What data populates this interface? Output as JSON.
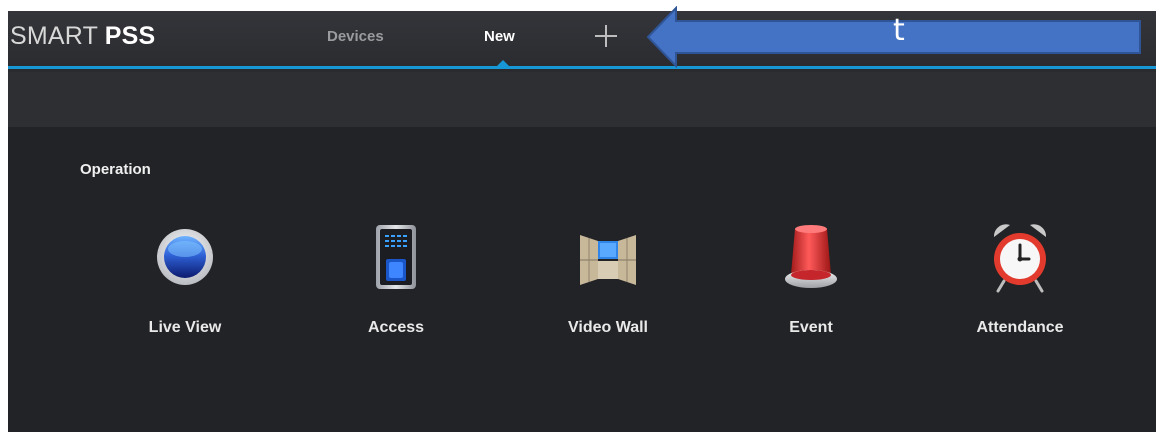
{
  "header": {
    "brand_light": "SMART ",
    "brand_bold": "PSS",
    "tabs": [
      {
        "label": "Devices",
        "active": false
      },
      {
        "label": "New",
        "active": true
      }
    ],
    "add_tab_icon": "plus-icon"
  },
  "main": {
    "section_title": "Operation",
    "apps": [
      {
        "label": "Live View",
        "icon": "live-view-icon"
      },
      {
        "label": "Access",
        "icon": "access-control-icon"
      },
      {
        "label": "Video Wall",
        "icon": "video-wall-icon"
      },
      {
        "label": "Event",
        "icon": "alarm-light-icon"
      },
      {
        "label": "Attendance",
        "icon": "alarm-clock-icon"
      }
    ]
  },
  "annotation": {
    "text": "t",
    "color": "#4472c4"
  },
  "colors": {
    "accent": "#1797d6",
    "background": "#2a2b2f",
    "panel": "#222326"
  }
}
